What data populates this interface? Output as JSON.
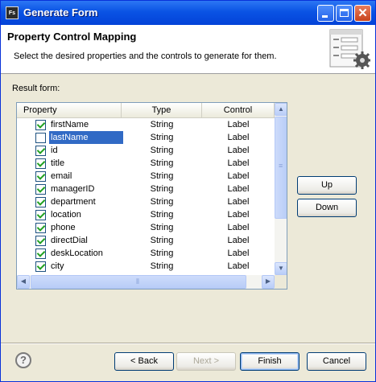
{
  "window": {
    "title": "Generate Form",
    "icon": "app-icon",
    "icon_text": "Fs"
  },
  "header": {
    "title": "Property Control Mapping",
    "description": "Select the desired properties and the controls to generate for them."
  },
  "result_label": "Result form:",
  "table": {
    "columns": [
      "Property",
      "Type",
      "Control"
    ],
    "rows": [
      {
        "name": "firstName",
        "type": "String",
        "control": "Label",
        "checked": true
      },
      {
        "name": "lastName",
        "type": "String",
        "control": "Label",
        "checked": false,
        "selected": true
      },
      {
        "name": "id",
        "type": "String",
        "control": "Label",
        "checked": true
      },
      {
        "name": "title",
        "type": "String",
        "control": "Label",
        "checked": true
      },
      {
        "name": "email",
        "type": "String",
        "control": "Label",
        "checked": true
      },
      {
        "name": "managerID",
        "type": "String",
        "control": "Label",
        "checked": true
      },
      {
        "name": "department",
        "type": "String",
        "control": "Label",
        "checked": true
      },
      {
        "name": "location",
        "type": "String",
        "control": "Label",
        "checked": true
      },
      {
        "name": "phone",
        "type": "String",
        "control": "Label",
        "checked": true
      },
      {
        "name": "directDial",
        "type": "String",
        "control": "Label",
        "checked": true
      },
      {
        "name": "deskLocation",
        "type": "String",
        "control": "Label",
        "checked": true
      },
      {
        "name": "city",
        "type": "String",
        "control": "Label",
        "checked": true
      }
    ]
  },
  "side_buttons": {
    "up": "Up",
    "down": "Down"
  },
  "footer": {
    "back": "< Back",
    "next": "Next >",
    "finish": "Finish",
    "cancel": "Cancel",
    "help_glyph": "?"
  },
  "colors": {
    "titlebar": "#0a53e4",
    "selection": "#316ac5",
    "check": "#21a121"
  }
}
